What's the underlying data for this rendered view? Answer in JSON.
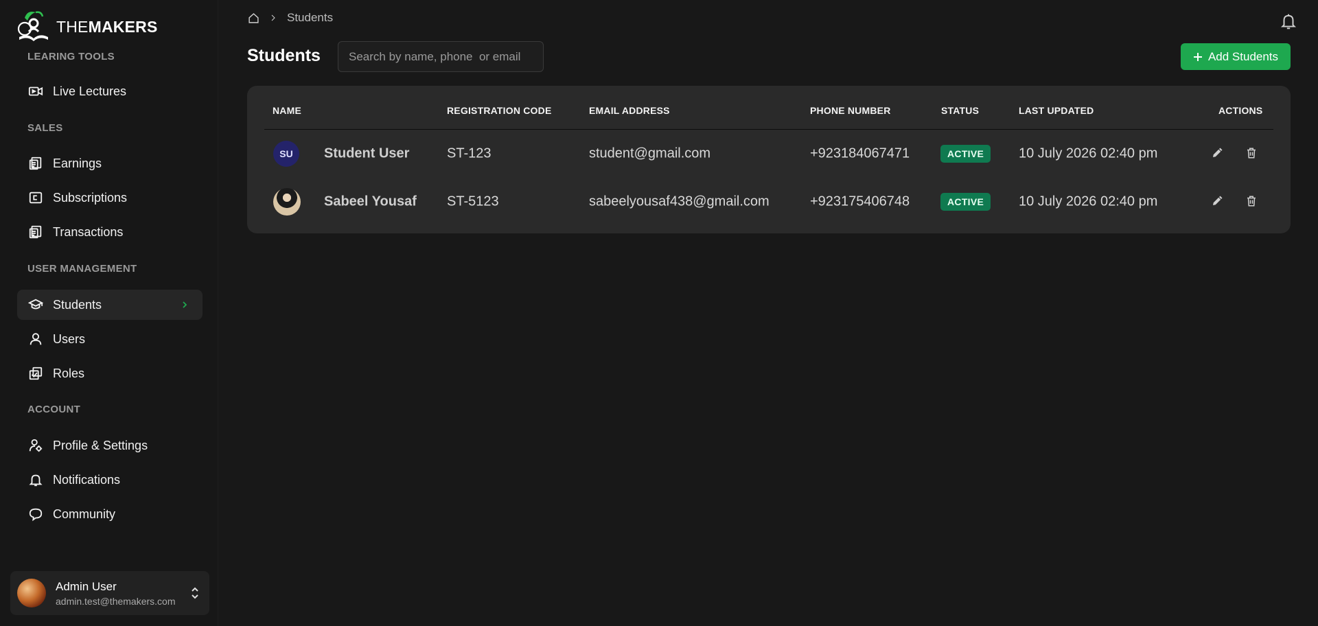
{
  "app": {
    "brand_light": "THE",
    "brand_bold": "MAKERS"
  },
  "colors": {
    "accent": "#1ea84f",
    "badge": "#0f7a50",
    "background": "#181818",
    "card": "#2a2a2a"
  },
  "sidebar": {
    "sections": [
      {
        "label": "LEARING TOOLS"
      },
      {
        "label": "SALES"
      },
      {
        "label": "USER MANAGEMENT"
      },
      {
        "label": "ACCOUNT"
      }
    ],
    "items": [
      {
        "label": "Live Lectures",
        "icon": "video-camera-icon"
      },
      {
        "label": "Earnings",
        "icon": "receipt-icon"
      },
      {
        "label": "Subscriptions",
        "icon": "card-icon"
      },
      {
        "label": "Transactions",
        "icon": "receipt-icon"
      },
      {
        "label": "Students",
        "icon": "graduation-cap-icon",
        "active": true
      },
      {
        "label": "Users",
        "icon": "user-icon"
      },
      {
        "label": "Roles",
        "icon": "roles-icon"
      },
      {
        "label": "Profile & Settings",
        "icon": "user-settings-icon"
      },
      {
        "label": "Notifications",
        "icon": "bell-icon"
      },
      {
        "label": "Community",
        "icon": "chat-bubble-icon"
      }
    ],
    "user": {
      "name": "Admin User",
      "email": "admin.test@themakers.com"
    }
  },
  "header": {
    "breadcrumb": [
      "Students"
    ],
    "title": "Students",
    "search_placeholder": "Search by name, phone  or email",
    "add_label": "Add Students"
  },
  "table": {
    "columns": [
      "NAME",
      "REGISTRATION CODE",
      "EMAIL ADDRESS",
      "PHONE NUMBER",
      "STATUS",
      "LAST UPDATED",
      "ACTIONS"
    ],
    "rows": [
      {
        "initials": "SU",
        "name": "Student User",
        "code": "ST-123",
        "email": "student@gmail.com",
        "phone": "+923184067471",
        "status": "ACTIVE",
        "updated": "10 July 2026 02:40 pm"
      },
      {
        "initials": "",
        "name": "Sabeel Yousaf",
        "code": "ST-5123",
        "email": "sabeelyousaf438@gmail.com",
        "phone": "+923175406748",
        "status": "ACTIVE",
        "updated": "10 July 2026 02:40 pm"
      }
    ]
  }
}
